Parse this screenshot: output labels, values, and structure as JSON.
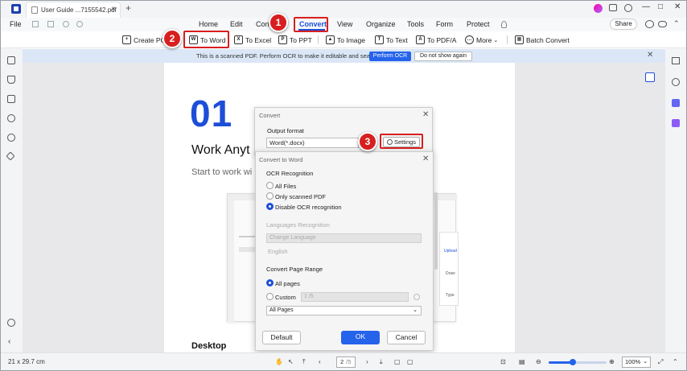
{
  "titlebar": {
    "tab_title": "User Guide ...7155542.pdf",
    "tab_close": "×",
    "new_tab": "+",
    "minimize": "—",
    "maximize": "□",
    "close": "✕"
  },
  "menubar": {
    "file": "File",
    "items": [
      "Home",
      "Edit",
      "Con",
      "Convert",
      "View",
      "Organize",
      "Tools",
      "Form",
      "Protect"
    ],
    "active": "Convert",
    "share": "Share"
  },
  "toolbar": {
    "create_pdf": "Create PC",
    "to_word": "To Word",
    "to_excel": "To Excel",
    "to_ppt": "To PPT",
    "to_image": "To Image",
    "to_text": "To Text",
    "to_pdfa": "To PDF/A",
    "more": "More",
    "batch_convert": "Batch Convert"
  },
  "banner": {
    "message": "This is a scanned PDF. Perform OCR to make it editable and searchable.",
    "perform_ocr": "Perform OCR",
    "do_not_show": "Do not show again"
  },
  "document": {
    "heading": "01",
    "title": "Work Anyt",
    "subtitle": "Start to work wi",
    "section": "Desktop",
    "mock_labels": [
      "Upload",
      "Draw",
      "Type"
    ]
  },
  "convert_dialog": {
    "title": "Convert",
    "output_format_label": "Output format",
    "output_format_value": "Word(*.docx)",
    "settings_button": "Settings"
  },
  "convert_to_word_dialog": {
    "title": "Convert to Word",
    "ocr_heading": "OCR Recognition",
    "ocr_options": [
      "All Files",
      "Only scanned PDF",
      "Disable OCR recognition"
    ],
    "ocr_selected": "Disable OCR recognition",
    "languages_heading": "Languages Recognition",
    "change_language": "Change Language",
    "language_value": "English",
    "page_range_heading": "Convert Page Range",
    "all_pages": "All pages",
    "custom": "Custom",
    "custom_placeholder": "1 /5",
    "page_select": "All Pages",
    "default_button": "Default",
    "ok_button": "OK",
    "cancel_button": "Cancel"
  },
  "markers": [
    "1",
    "2",
    "3"
  ],
  "statusbar": {
    "page_size": "21 x 29.7 cm",
    "current_page": "2",
    "total_pages": "/5",
    "zoom": "100%",
    "zoom_level": 0.42
  },
  "colors": {
    "accent": "#1d4ed8",
    "highlight": "#d71f1f"
  }
}
